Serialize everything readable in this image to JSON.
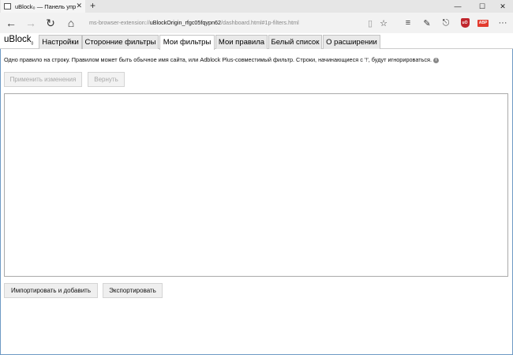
{
  "browser": {
    "tab_title": "uBlock₀ — Панель упр",
    "new_tab_symbol": "+",
    "address_prefix": "ms-browser-extension://",
    "address_host": "uBlockOrigin_rfgc05fqypn62",
    "address_path": "/dashboard.html#1p-filters.html"
  },
  "dashboard": {
    "brand": "uBlock",
    "brand_sub": "0",
    "tabs": [
      {
        "label": "Настройки"
      },
      {
        "label": "Сторонние фильтры"
      },
      {
        "label": "Мои фильтры"
      },
      {
        "label": "Мои правила"
      },
      {
        "label": "Белый список"
      },
      {
        "label": "О расширении"
      }
    ],
    "active_tab": "Мои фильтры"
  },
  "content": {
    "description": "Одно правило на строку. Правилом может быть обычное имя сайта, или Adblock Plus-совместимый фильтр. Строки, начинающиеся с '!', будут игнорироваться.",
    "info_glyph": "i",
    "apply_button": "Применить изменения",
    "revert_button": "Вернуть",
    "filters_text": "",
    "import_button": "Импортировать и добавить",
    "export_button": "Экспортировать"
  },
  "colors": {
    "ublock_red": "#c0262d",
    "abp_red": "#e23b2e",
    "window_border": "#6e9ac4"
  },
  "icons": [
    "tab-close-icon",
    "minimize-icon",
    "maximize-icon",
    "window-close-icon",
    "back-icon",
    "forward-icon",
    "refresh-icon",
    "home-icon",
    "reading-view-icon",
    "favorite-star-icon",
    "hub-icon",
    "share-icon",
    "ublock-icon",
    "adblock-plus-icon",
    "more-icon",
    "info-icon"
  ]
}
